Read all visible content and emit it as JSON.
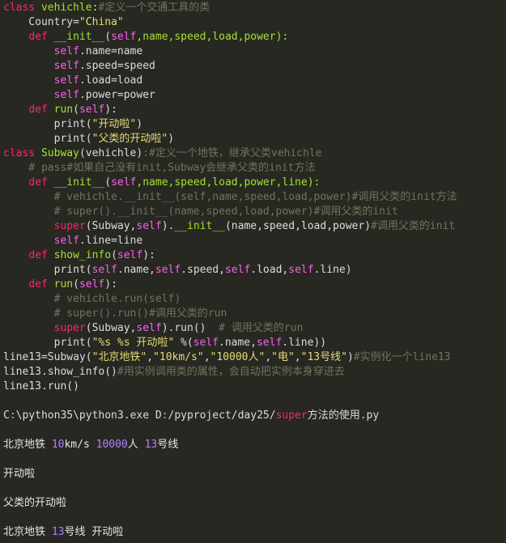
{
  "code_lines": [
    [
      {
        "t": "class",
        "c": "kw"
      },
      {
        "t": " vehichle",
        "c": "fn"
      },
      {
        "t": ":",
        "c": "pl"
      },
      {
        "t": "#定义一个交通工具的类",
        "c": "cm"
      }
    ],
    [
      {
        "t": "    Country=",
        "c": "pl"
      },
      {
        "t": "\"China\"",
        "c": "str"
      }
    ],
    [
      {
        "t": "    ",
        "c": "pl"
      },
      {
        "t": "def",
        "c": "kw"
      },
      {
        "t": " __init__",
        "c": "fn"
      },
      {
        "t": "(",
        "c": "pl"
      },
      {
        "t": "self",
        "c": "self"
      },
      {
        "t": ",name,speed,load,power):",
        "c": "fn"
      }
    ],
    [
      {
        "t": "        ",
        "c": "pl"
      },
      {
        "t": "self",
        "c": "self"
      },
      {
        "t": ".name=name",
        "c": "pl"
      }
    ],
    [
      {
        "t": "        ",
        "c": "pl"
      },
      {
        "t": "self",
        "c": "self"
      },
      {
        "t": ".speed=speed",
        "c": "pl"
      }
    ],
    [
      {
        "t": "        ",
        "c": "pl"
      },
      {
        "t": "self",
        "c": "self"
      },
      {
        "t": ".load=load",
        "c": "pl"
      }
    ],
    [
      {
        "t": "        ",
        "c": "pl"
      },
      {
        "t": "self",
        "c": "self"
      },
      {
        "t": ".power=power",
        "c": "pl"
      }
    ],
    [
      {
        "t": "    ",
        "c": "pl"
      },
      {
        "t": "def",
        "c": "kw"
      },
      {
        "t": " run",
        "c": "fn"
      },
      {
        "t": "(",
        "c": "pl"
      },
      {
        "t": "self",
        "c": "self"
      },
      {
        "t": "):",
        "c": "pl"
      }
    ],
    [
      {
        "t": "        print(",
        "c": "pl"
      },
      {
        "t": "\"开动啦\"",
        "c": "str"
      },
      {
        "t": ")",
        "c": "pl"
      }
    ],
    [
      {
        "t": "        print(",
        "c": "pl"
      },
      {
        "t": "\"父类的开动啦\"",
        "c": "str"
      },
      {
        "t": ")",
        "c": "pl"
      }
    ],
    [
      {
        "t": "class",
        "c": "kw"
      },
      {
        "t": " Subway",
        "c": "fn"
      },
      {
        "t": "(vehichle)",
        "c": "pl"
      },
      {
        "t": ":#定义一个地铁，继承父类vehichle",
        "c": "cm"
      }
    ],
    [
      {
        "t": "    # pass#如果自己没有init,Subway会继承父类的init方法",
        "c": "cm"
      }
    ],
    [
      {
        "t": "    ",
        "c": "pl"
      },
      {
        "t": "def",
        "c": "kw"
      },
      {
        "t": " __init__",
        "c": "fn"
      },
      {
        "t": "(",
        "c": "pl"
      },
      {
        "t": "self",
        "c": "self"
      },
      {
        "t": ",name,speed,load,power,line):",
        "c": "fn"
      }
    ],
    [
      {
        "t": "        # vehichle.__init__(self,name,speed,load,power)#调用父类的init方法",
        "c": "cm"
      }
    ],
    [
      {
        "t": "        # super().__init__(name,speed,load,power)#调用父类的init",
        "c": "cm"
      }
    ],
    [
      {
        "t": "        ",
        "c": "pl"
      },
      {
        "t": "super",
        "c": "kw"
      },
      {
        "t": "(Subway,",
        "c": "pl"
      },
      {
        "t": "self",
        "c": "self"
      },
      {
        "t": ").",
        "c": "pl"
      },
      {
        "t": "__init__",
        "c": "fn"
      },
      {
        "t": "(name,speed,load,power)",
        "c": "pl"
      },
      {
        "t": "#调用父类的init",
        "c": "cm"
      }
    ],
    [
      {
        "t": "        ",
        "c": "pl"
      },
      {
        "t": "self",
        "c": "self"
      },
      {
        "t": ".line=line",
        "c": "pl"
      }
    ],
    [
      {
        "t": "    ",
        "c": "pl"
      },
      {
        "t": "def",
        "c": "kw"
      },
      {
        "t": " show_info",
        "c": "fn"
      },
      {
        "t": "(",
        "c": "pl"
      },
      {
        "t": "self",
        "c": "self"
      },
      {
        "t": "):",
        "c": "pl"
      }
    ],
    [
      {
        "t": "        print(",
        "c": "pl"
      },
      {
        "t": "self",
        "c": "self"
      },
      {
        "t": ".name,",
        "c": "pl"
      },
      {
        "t": "self",
        "c": "self"
      },
      {
        "t": ".speed,",
        "c": "pl"
      },
      {
        "t": "self",
        "c": "self"
      },
      {
        "t": ".load,",
        "c": "pl"
      },
      {
        "t": "self",
        "c": "self"
      },
      {
        "t": ".line)",
        "c": "pl"
      }
    ],
    [
      {
        "t": "    ",
        "c": "pl"
      },
      {
        "t": "def",
        "c": "kw"
      },
      {
        "t": " run",
        "c": "fn"
      },
      {
        "t": "(",
        "c": "pl"
      },
      {
        "t": "self",
        "c": "self"
      },
      {
        "t": "):",
        "c": "pl"
      }
    ],
    [
      {
        "t": "        # vehichle.run(self)",
        "c": "cm"
      }
    ],
    [
      {
        "t": "        # super().run()#调用父类的run",
        "c": "cm"
      }
    ],
    [
      {
        "t": "        ",
        "c": "pl"
      },
      {
        "t": "super",
        "c": "kw"
      },
      {
        "t": "(Subway,",
        "c": "pl"
      },
      {
        "t": "self",
        "c": "self"
      },
      {
        "t": ").run()  ",
        "c": "pl"
      },
      {
        "t": "# 调用父类的run",
        "c": "cm"
      }
    ],
    [
      {
        "t": "        print(",
        "c": "pl"
      },
      {
        "t": "\"%s %s 开动啦\"",
        "c": "str"
      },
      {
        "t": " %(",
        "c": "pl"
      },
      {
        "t": "self",
        "c": "self"
      },
      {
        "t": ".name,",
        "c": "pl"
      },
      {
        "t": "self",
        "c": "self"
      },
      {
        "t": ".line))",
        "c": "pl"
      }
    ],
    [
      {
        "t": "line13=Subway(",
        "c": "pl"
      },
      {
        "t": "\"北京地铁\"",
        "c": "str"
      },
      {
        "t": ",",
        "c": "pl"
      },
      {
        "t": "\"10km/s\"",
        "c": "str"
      },
      {
        "t": ",",
        "c": "pl"
      },
      {
        "t": "\"10000人\"",
        "c": "str"
      },
      {
        "t": ",",
        "c": "pl"
      },
      {
        "t": "\"电\"",
        "c": "str"
      },
      {
        "t": ",",
        "c": "pl"
      },
      {
        "t": "\"13号线\"",
        "c": "str"
      },
      {
        "t": ")",
        "c": "pl"
      },
      {
        "t": "#实例化一个line13",
        "c": "cm"
      }
    ],
    [
      {
        "t": "line13.show_info()",
        "c": "pl"
      },
      {
        "t": "#用实例调用类的属性，会自动把实例本身穿进去",
        "c": "cm"
      }
    ],
    [
      {
        "t": "line13.run()",
        "c": "pl"
      }
    ]
  ],
  "output_lines": [
    [
      {
        "t": "C",
        "c": "pl"
      },
      {
        "t": ":",
        "c": "fn"
      },
      {
        "t": "\\python35\\python3.exe ",
        "c": "pl"
      },
      {
        "t": "D",
        "c": "pl"
      },
      {
        "t": ":",
        "c": "fn"
      },
      {
        "t": "/pyproject/day25/",
        "c": "pl"
      },
      {
        "t": "super",
        "c": "kw"
      },
      {
        "t": "方法的使用.py",
        "c": "pl"
      }
    ],
    [
      {
        "t": "北京地铁 ",
        "c": "out"
      },
      {
        "t": "10",
        "c": "num"
      },
      {
        "t": "km/s ",
        "c": "out"
      },
      {
        "t": "10000",
        "c": "num"
      },
      {
        "t": "人 ",
        "c": "out"
      },
      {
        "t": "13",
        "c": "num"
      },
      {
        "t": "号线",
        "c": "out"
      }
    ],
    [
      {
        "t": "开动啦",
        "c": "out"
      }
    ],
    [
      {
        "t": "父类的开动啦",
        "c": "out"
      }
    ],
    [
      {
        "t": "北京地铁 ",
        "c": "out"
      },
      {
        "t": "13",
        "c": "num"
      },
      {
        "t": "号线 开动啦",
        "c": "out"
      }
    ]
  ],
  "colors": {
    "background": "#272822",
    "keyword": "#f92672",
    "function": "#a6e22e",
    "string": "#e6db74",
    "comment": "#75715e",
    "number": "#ae81ff",
    "self": "#fd5ff0",
    "plain": "#dcdcdc"
  }
}
